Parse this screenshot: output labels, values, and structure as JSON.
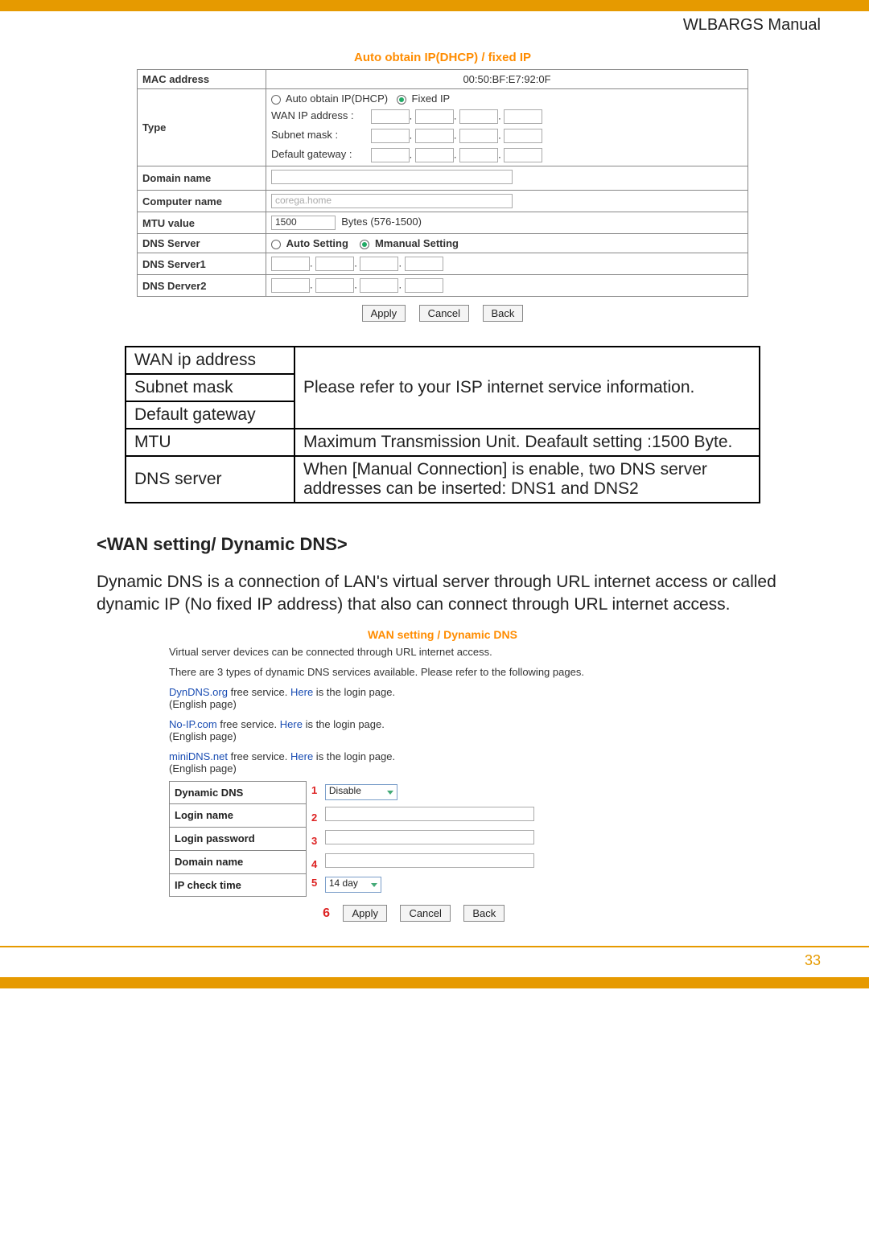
{
  "header": {
    "manual_label": "WLBARGS Manual"
  },
  "screenshot1": {
    "title": "Auto obtain IP(DHCP) / fixed IP",
    "rows": {
      "mac_label": "MAC address",
      "mac_value": "00:50:BF:E7:92:0F",
      "type_label": "Type",
      "type_opt_auto": "Auto obtain IP(DHCP)",
      "type_opt_fixed": "Fixed IP",
      "wan_ip_label": "WAN IP address :",
      "subnet_label": "Subnet mask :",
      "gateway_label": "Default gateway :",
      "domain_label": "Domain name",
      "computer_label": "Computer name",
      "computer_placeholder": "corega.home",
      "mtu_label": "MTU value",
      "mtu_value": "1500",
      "mtu_suffix": "Bytes (576-1500)",
      "dns_label": "DNS Server",
      "dns_auto": "Auto Setting",
      "dns_manual": "Mmanual Setting",
      "dns1_label": "DNS Server1",
      "dns2_label": "DNS Derver2"
    },
    "buttons": {
      "apply": "Apply",
      "cancel": "Cancel",
      "back": "Back"
    }
  },
  "desc_table": {
    "r1": "WAN ip address",
    "r2": "Subnet mask",
    "r3": "Default gateway",
    "merged": "Please refer to your ISP internet service information.",
    "r4l": "MTU",
    "r4v": "Maximum Transmission Unit. Deafault setting :1500 Byte.",
    "r5l": "DNS server",
    "r5v": "When [Manual Connection] is enable, two DNS server addresses can be inserted: DNS1 and DNS2"
  },
  "section": {
    "heading": "<WAN setting/ Dynamic DNS>",
    "body": "Dynamic DNS is a connection of LAN's virtual server through URL internet access or called dynamic IP (No fixed IP address) that also can connect through URL internet access."
  },
  "screenshot2": {
    "title": "WAN setting / Dynamic DNS",
    "intro1": "Virtual server devices can be connected through URL internet access.",
    "intro2": "There are 3 types of dynamic DNS services available. Please refer to the following pages.",
    "s1a": "DynDNS.org",
    "s1b": "  free service. ",
    "here": "Here",
    "s1c": " is the login page.",
    "eng": "(English page)",
    "s2a": "No-IP.com",
    "s2b": "  free service. ",
    "s3a": "miniDNS.net",
    "s3b": "  free service. ",
    "tbl": {
      "r1": "Dynamic DNS",
      "r1sel": "Disable",
      "r2": "Login name",
      "r3": "Login password",
      "r4": "Domain name",
      "r5": "IP check time",
      "r5sel": "14 day"
    },
    "nums": {
      "n1": "1",
      "n2": "2",
      "n3": "3",
      "n4": "4",
      "n5": "5",
      "n6": "6"
    },
    "buttons": {
      "apply": "Apply",
      "cancel": "Cancel",
      "back": "Back"
    }
  },
  "footer": {
    "page_num": "33"
  }
}
